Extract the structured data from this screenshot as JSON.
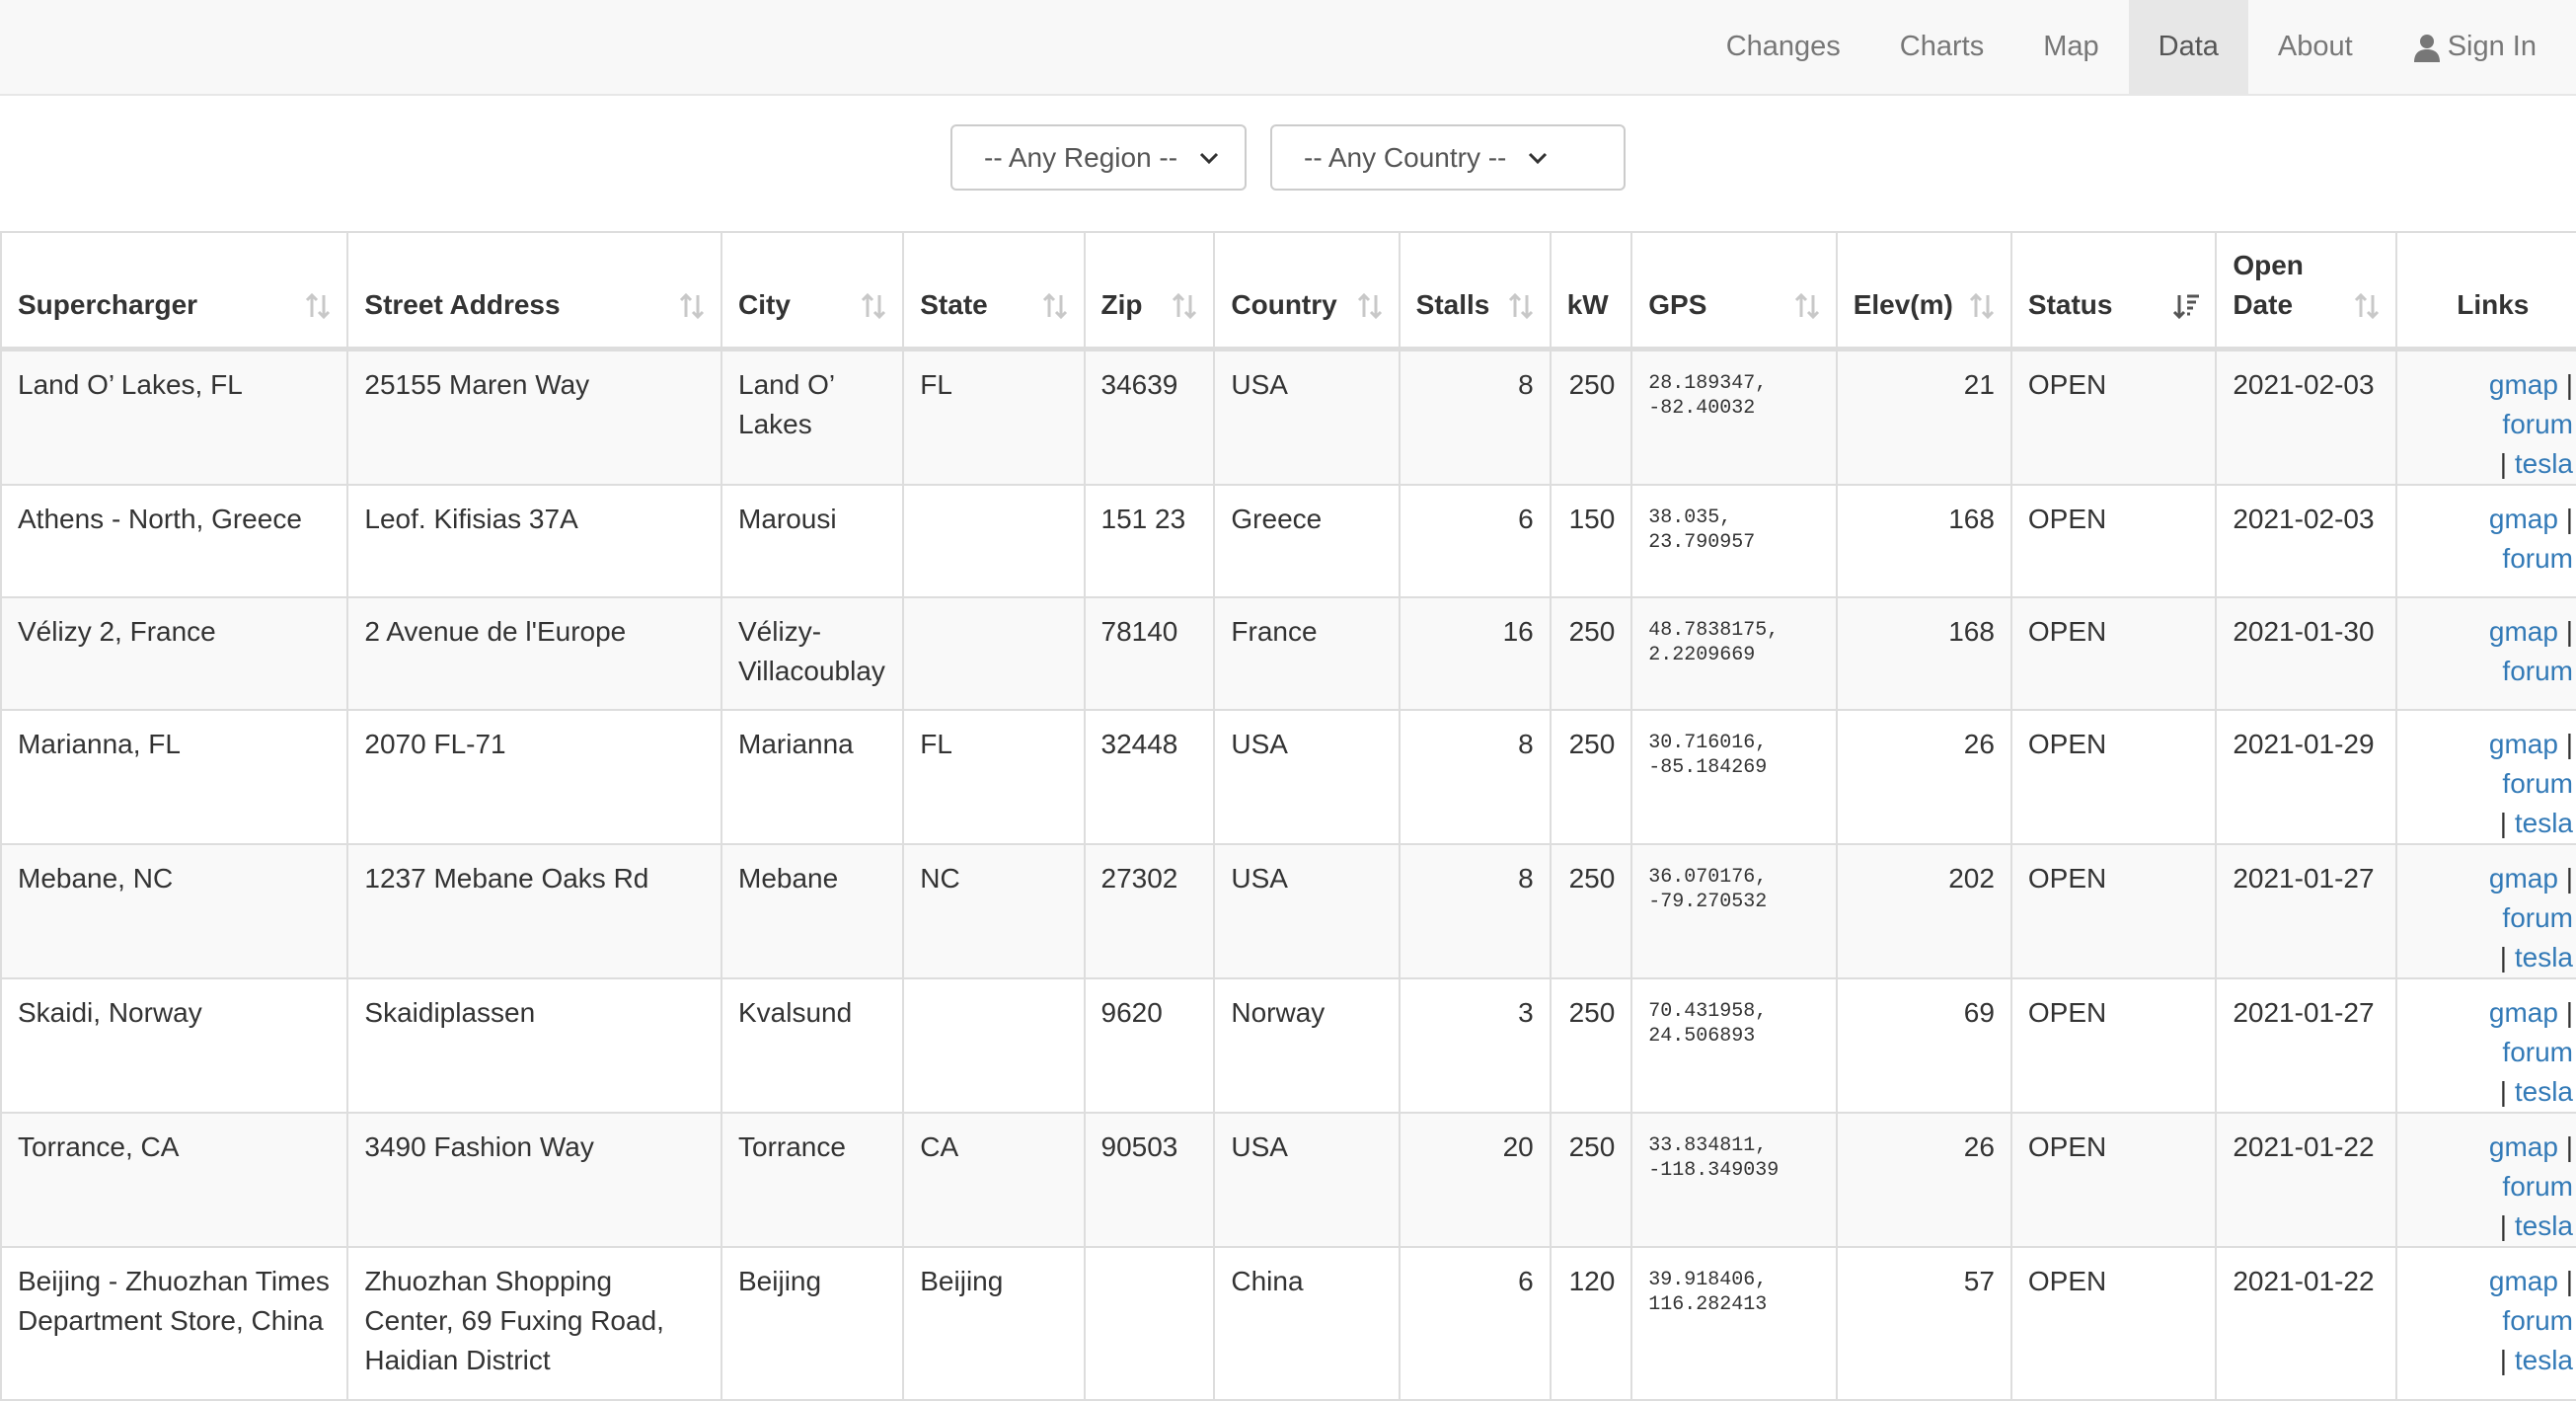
{
  "nav": {
    "items": [
      {
        "label": "Changes"
      },
      {
        "label": "Charts"
      },
      {
        "label": "Map"
      },
      {
        "label": "Data",
        "active": true
      },
      {
        "label": "About"
      }
    ],
    "sign_in_label": "Sign In"
  },
  "filters": {
    "region": "-- Any Region --",
    "country": "-- Any Country --"
  },
  "table": {
    "columns": {
      "supercharger": "Supercharger",
      "street": "Street Address",
      "city": "City",
      "state": "State",
      "zip": "Zip",
      "country": "Country",
      "stalls": "Stalls",
      "kw": "kW",
      "gps": "GPS",
      "elev": "Elev(m)",
      "status": "Status",
      "open_date": "Open Date",
      "links": "Links"
    },
    "link_labels": {
      "gmap": "gmap",
      "forum": "forum",
      "tesla": "tesla",
      "sep": "|"
    },
    "rows": [
      {
        "name": "Land O’ Lakes, FL",
        "street": "25155 Maren Way",
        "city": "Land O’ Lakes",
        "state": "FL",
        "zip": "34639",
        "country": "USA",
        "stalls": "8",
        "kw": "250",
        "gps_lat": "28.189347,",
        "gps_lon": "-82.40032",
        "elev": "21",
        "status": "OPEN",
        "open_date": "2021-02-03",
        "has_tesla": true
      },
      {
        "name": "Athens - North, Greece",
        "street": "Leof. Kifisias 37A",
        "city": "Marousi",
        "state": "",
        "zip": "151 23",
        "country": "Greece",
        "stalls": "6",
        "kw": "150",
        "gps_lat": "38.035,",
        "gps_lon": "23.790957",
        "elev": "168",
        "status": "OPEN",
        "open_date": "2021-02-03",
        "has_tesla": false
      },
      {
        "name": "Vélizy 2, France",
        "street": "2 Avenue de l'Europe",
        "city": "Vélizy-Villacoublay",
        "state": "",
        "zip": "78140",
        "country": "France",
        "stalls": "16",
        "kw": "250",
        "gps_lat": "48.7838175,",
        "gps_lon": "2.2209669",
        "elev": "168",
        "status": "OPEN",
        "open_date": "2021-01-30",
        "has_tesla": false
      },
      {
        "name": "Marianna, FL",
        "street": "2070 FL-71",
        "city": "Marianna",
        "state": "FL",
        "zip": "32448",
        "country": "USA",
        "stalls": "8",
        "kw": "250",
        "gps_lat": "30.716016,",
        "gps_lon": "-85.184269",
        "elev": "26",
        "status": "OPEN",
        "open_date": "2021-01-29",
        "has_tesla": true
      },
      {
        "name": "Mebane, NC",
        "street": "1237 Mebane Oaks Rd",
        "city": "Mebane",
        "state": "NC",
        "zip": "27302",
        "country": "USA",
        "stalls": "8",
        "kw": "250",
        "gps_lat": "36.070176,",
        "gps_lon": "-79.270532",
        "elev": "202",
        "status": "OPEN",
        "open_date": "2021-01-27",
        "has_tesla": true
      },
      {
        "name": "Skaidi, Norway",
        "street": "Skaidiplassen",
        "city": "Kvalsund",
        "state": "",
        "zip": "9620",
        "country": "Norway",
        "stalls": "3",
        "kw": "250",
        "gps_lat": "70.431958,",
        "gps_lon": "24.506893",
        "elev": "69",
        "status": "OPEN",
        "open_date": "2021-01-27",
        "has_tesla": true
      },
      {
        "name": "Torrance, CA",
        "street": "3490 Fashion Way",
        "city": "Torrance",
        "state": "CA",
        "zip": "90503",
        "country": "USA",
        "stalls": "20",
        "kw": "250",
        "gps_lat": "33.834811,",
        "gps_lon": "-118.349039",
        "elev": "26",
        "status": "OPEN",
        "open_date": "2021-01-22",
        "has_tesla": true
      },
      {
        "name": "Beijing - Zhuozhan Times Department Store, China",
        "street": "Zhuozhan Shopping Center, 69 Fuxing Road, Haidian District",
        "city": "Beijing",
        "state": "Beijing",
        "zip": "",
        "country": "China",
        "stalls": "6",
        "kw": "120",
        "gps_lat": "39.918406,",
        "gps_lon": "116.282413",
        "elev": "57",
        "status": "OPEN",
        "open_date": "2021-01-22",
        "has_tesla": true
      }
    ]
  },
  "colors": {
    "link": "#337ab7",
    "navbar_bg": "#f8f8f8",
    "nav_active_bg": "#e7e7e7",
    "stripe": "#f9f9f9"
  }
}
